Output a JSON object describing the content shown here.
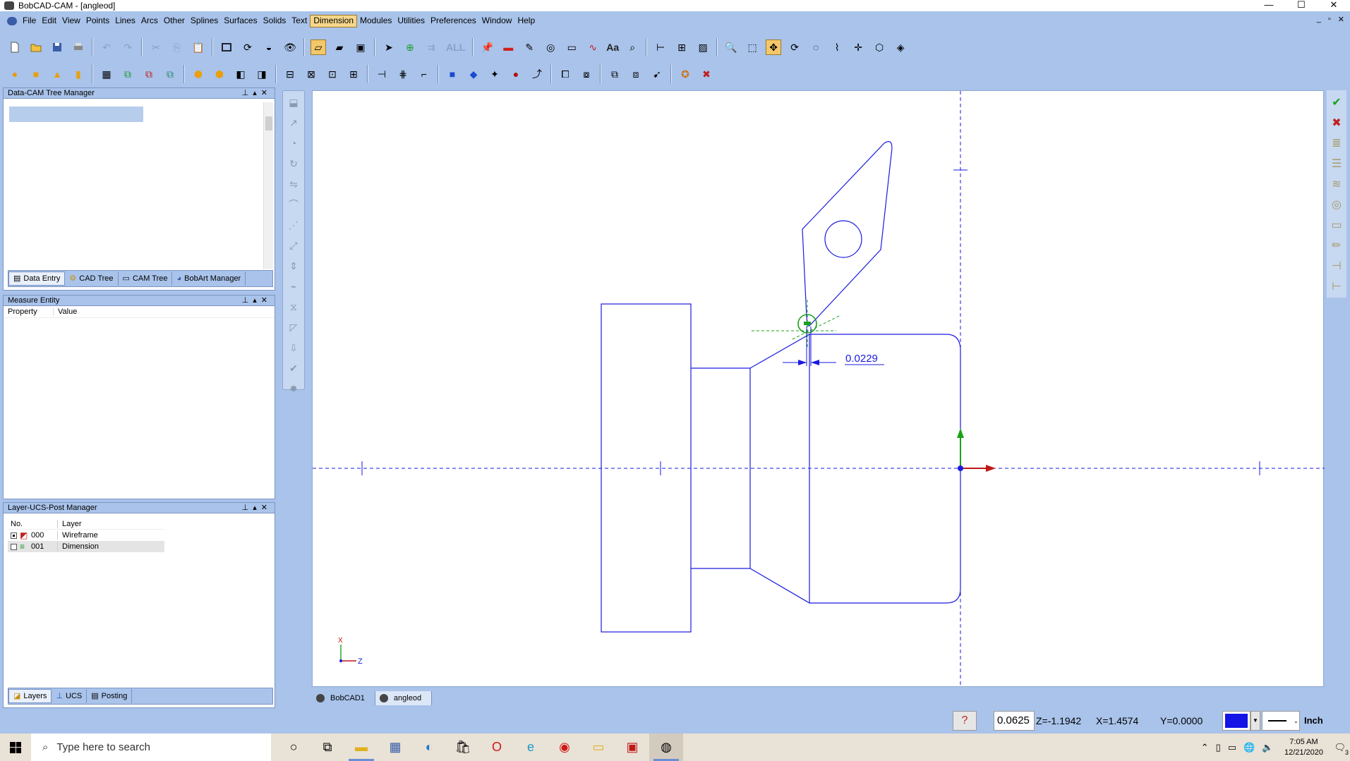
{
  "window": {
    "title": "BobCAD-CAM - [angleod]",
    "controls": [
      "—",
      "☐",
      "✕"
    ],
    "mdi_controls": [
      "_",
      "▫",
      "✕"
    ]
  },
  "menu": [
    "File",
    "Edit",
    "View",
    "Points",
    "Lines",
    "Arcs",
    "Other",
    "Splines",
    "Surfaces",
    "Solids",
    "Text",
    "Dimension",
    "Modules",
    "Utilities",
    "Preferences",
    "Window",
    "Help"
  ],
  "toolbar": {
    "all_label": "ALL",
    "text_label": "Aa"
  },
  "tree_panel": {
    "title": "Data-CAM Tree Manager",
    "tabs": [
      "Data Entry",
      "CAD Tree",
      "CAM Tree",
      "BobArt Manager"
    ]
  },
  "measure_panel": {
    "title": "Measure Entity",
    "columns": [
      "Property",
      "Value"
    ]
  },
  "layer_panel": {
    "title": "Layer-UCS-Post Manager",
    "columns": [
      "No.",
      "Layer"
    ],
    "rows": [
      {
        "no": "000",
        "layer": "Wireframe",
        "checked": true
      },
      {
        "no": "001",
        "layer": "Dimension",
        "checked": false
      }
    ],
    "tabs": [
      "Layers",
      "UCS",
      "Posting"
    ]
  },
  "drawing": {
    "dimension_text": "0.0229",
    "axis_labels": {
      "x": "X",
      "z": "Z"
    },
    "geometry_color": "#1a1ae0"
  },
  "doc_tabs": [
    "BobCAD1",
    "angleod"
  ],
  "status": {
    "value_field": "0.0625",
    "z": "Z=-1.1942",
    "x": "X=1.4574",
    "y": "Y=0.0000",
    "color": "#1414e6",
    "unit": "Inch"
  },
  "taskbar": {
    "search_placeholder": "Type here to search",
    "time": "7:05 AM",
    "date": "12/21/2020",
    "notification_count": "3"
  }
}
